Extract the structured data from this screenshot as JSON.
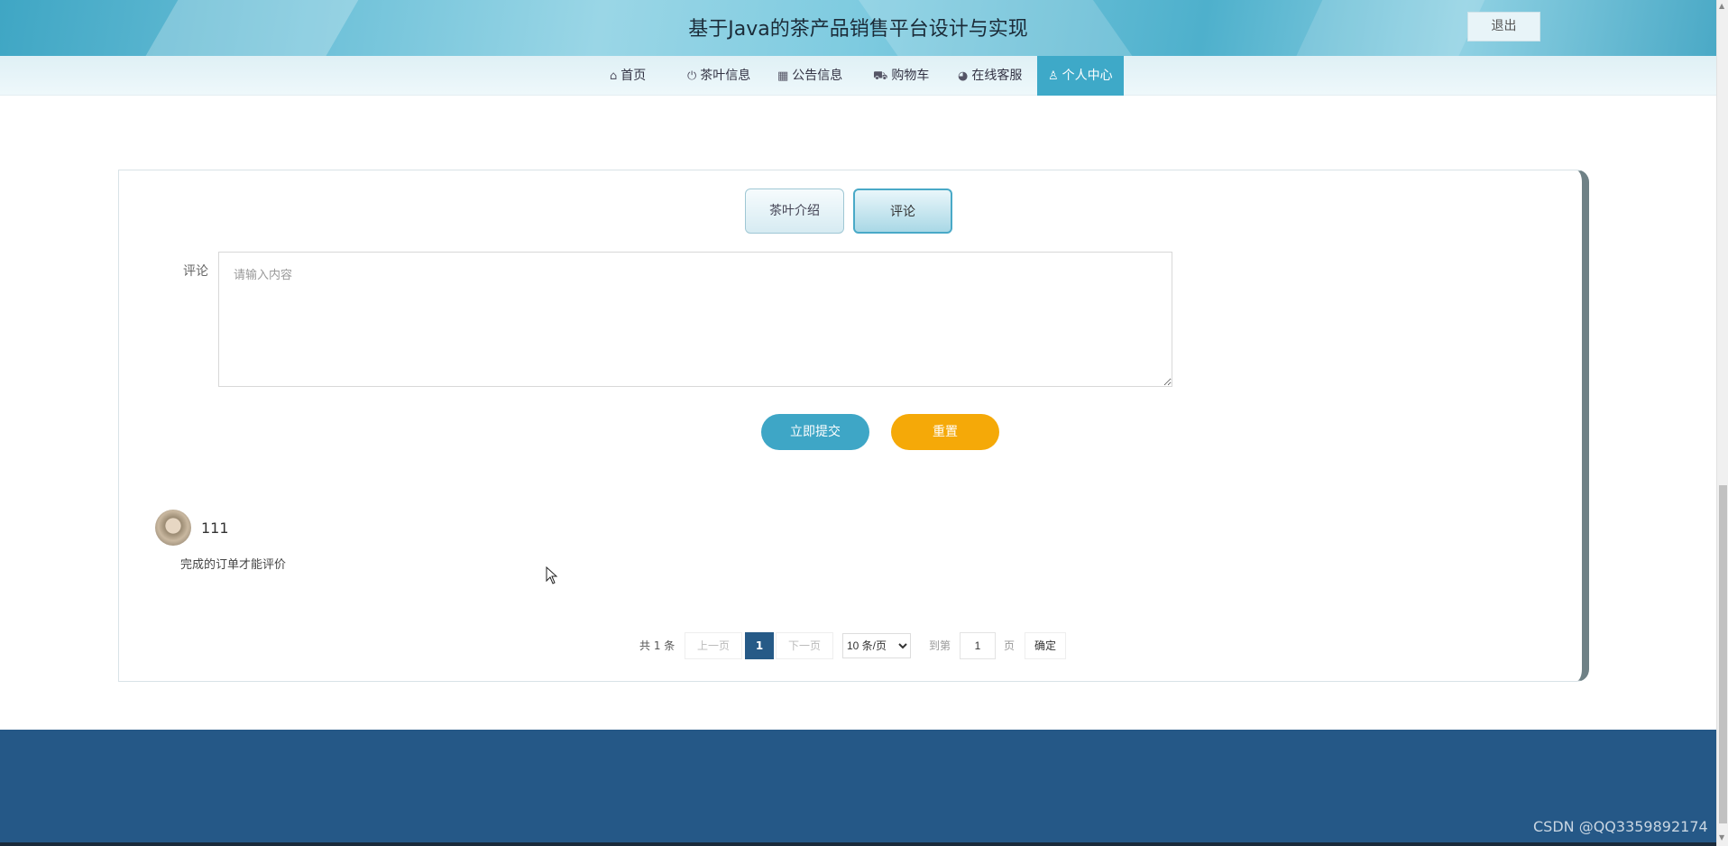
{
  "header": {
    "site_title": "基于Java的茶产品销售平台设计与实现",
    "logout_label": "退出"
  },
  "nav": {
    "items": [
      {
        "label": "首页",
        "icon": "home-icon"
      },
      {
        "label": "茶叶信息",
        "icon": "power-icon"
      },
      {
        "label": "公告信息",
        "icon": "calendar-icon"
      },
      {
        "label": "购物车",
        "icon": "cart-icon"
      },
      {
        "label": "在线客服",
        "icon": "support-icon"
      },
      {
        "label": "个人中心",
        "icon": "user-icon",
        "active": true
      }
    ]
  },
  "tabs": {
    "intro_label": "茶叶介绍",
    "comment_label": "评论"
  },
  "form": {
    "comment_label": "评论",
    "comment_placeholder": "请输入内容",
    "comment_value": "",
    "submit_label": "立即提交",
    "reset_label": "重置"
  },
  "comments": [
    {
      "username": "111",
      "text": "完成的订单才能评价"
    }
  ],
  "pagination": {
    "total_text": "共 1 条",
    "prev_label": "上一页",
    "current_page": "1",
    "next_label": "下一页",
    "page_size_selected": "10 条/页",
    "goto_label": "到第",
    "goto_value": "1",
    "page_unit": "页",
    "confirm_label": "确定"
  },
  "watermark": "CSDN @QQ3359892174",
  "colors": {
    "accent": "#3ea9c8",
    "reset": "#f5a908",
    "footer": "#255887",
    "pager_current": "#265a87"
  }
}
